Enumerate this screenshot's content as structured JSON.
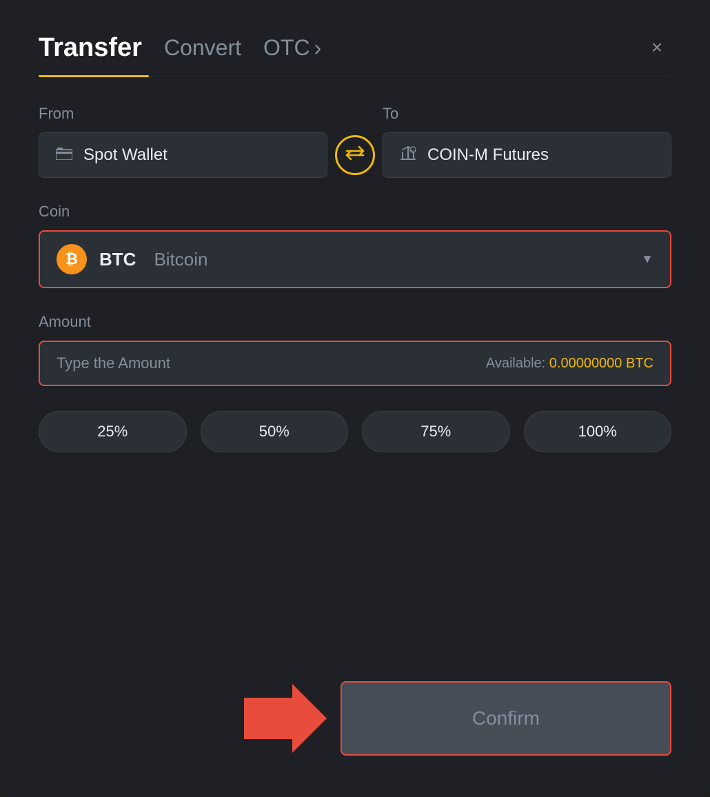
{
  "header": {
    "active_tab": "Transfer",
    "tabs": [
      "Transfer",
      "Convert",
      "OTC"
    ],
    "close_label": "×"
  },
  "from_section": {
    "label": "From",
    "wallet_label": "Spot Wallet"
  },
  "to_section": {
    "label": "To",
    "wallet_label": "COIN-M Futures"
  },
  "swap_button": {
    "icon": "⇄"
  },
  "coin_section": {
    "label": "Coin",
    "coin_ticker": "BTC",
    "coin_name": "Bitcoin",
    "dropdown_arrow": "▼"
  },
  "amount_section": {
    "label": "Amount",
    "placeholder": "Type the Amount",
    "available_label": "Available:",
    "available_amount": "0.00000000",
    "available_currency": "BTC"
  },
  "percentage_buttons": [
    "25%",
    "50%",
    "75%",
    "100%"
  ],
  "confirm_button": {
    "label": "Confirm"
  }
}
